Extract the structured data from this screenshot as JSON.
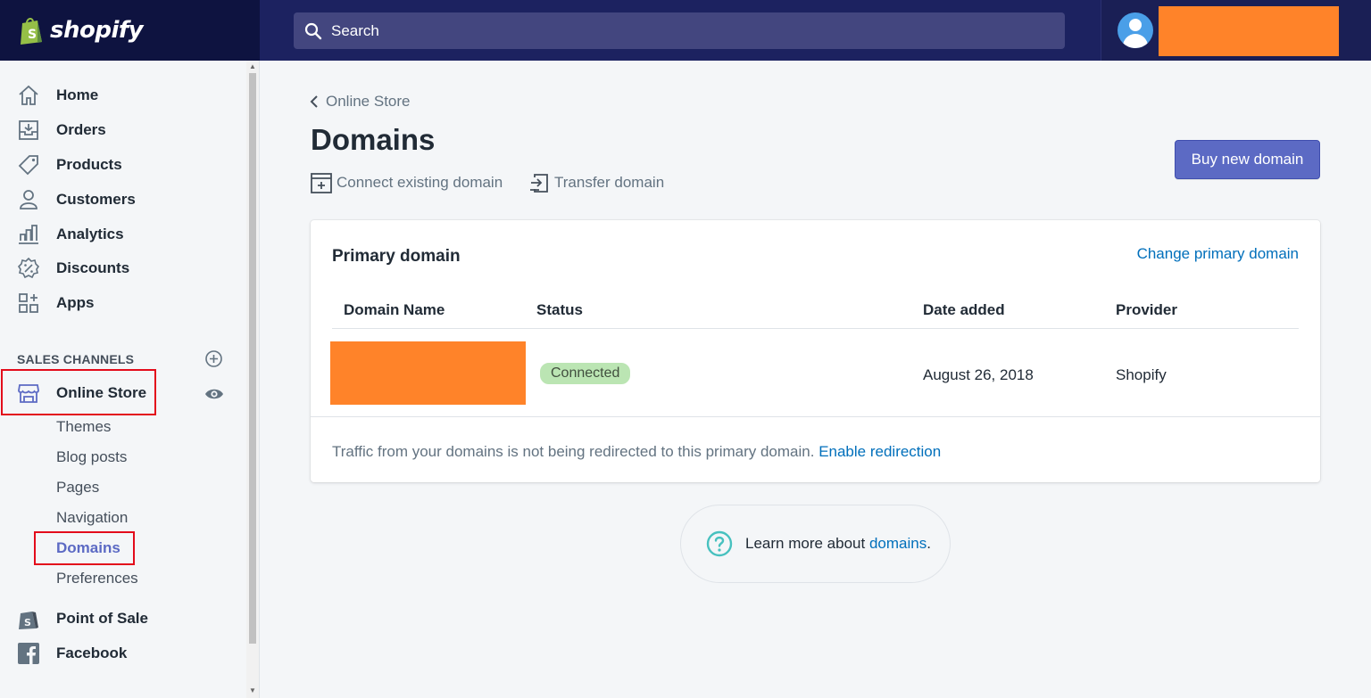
{
  "topbar": {
    "logo_text": "shopify",
    "search_placeholder": "Search"
  },
  "sidebar": {
    "items": [
      {
        "label": "Home",
        "icon": "home-icon"
      },
      {
        "label": "Orders",
        "icon": "orders-icon"
      },
      {
        "label": "Products",
        "icon": "tag-icon"
      },
      {
        "label": "Customers",
        "icon": "person-icon"
      },
      {
        "label": "Analytics",
        "icon": "bar-chart-icon"
      },
      {
        "label": "Discounts",
        "icon": "discount-icon"
      },
      {
        "label": "Apps",
        "icon": "apps-icon"
      }
    ],
    "section_heading": "SALES CHANNELS",
    "online_store": "Online Store",
    "sub_items": [
      "Themes",
      "Blog posts",
      "Pages",
      "Navigation",
      "Domains",
      "Preferences"
    ],
    "point_of_sale": "Point of Sale",
    "facebook": "Facebook"
  },
  "main": {
    "breadcrumb": "Online Store",
    "title": "Domains",
    "actions": {
      "connect": "Connect existing domain",
      "transfer": "Transfer domain"
    },
    "buy_button": "Buy new domain",
    "card": {
      "title": "Primary domain",
      "change_link": "Change primary domain",
      "columns": [
        "Domain Name",
        "Status",
        "Date added",
        "Provider"
      ],
      "row": {
        "status": "Connected",
        "date_added": "August 26, 2018",
        "provider": "Shopify"
      },
      "footer_text": "Traffic from your domains is not being redirected to this primary domain.",
      "footer_link": "Enable redirection"
    },
    "help": {
      "text": "Learn more about",
      "link": "domains",
      "suffix": "."
    }
  },
  "colors": {
    "topbar": "#1c2260",
    "accent": "#5c6ac4",
    "link": "#006fbb",
    "badge_success": "#bbe5b3",
    "redaction": "#ff8329",
    "highlight": "#e30b1b"
  }
}
